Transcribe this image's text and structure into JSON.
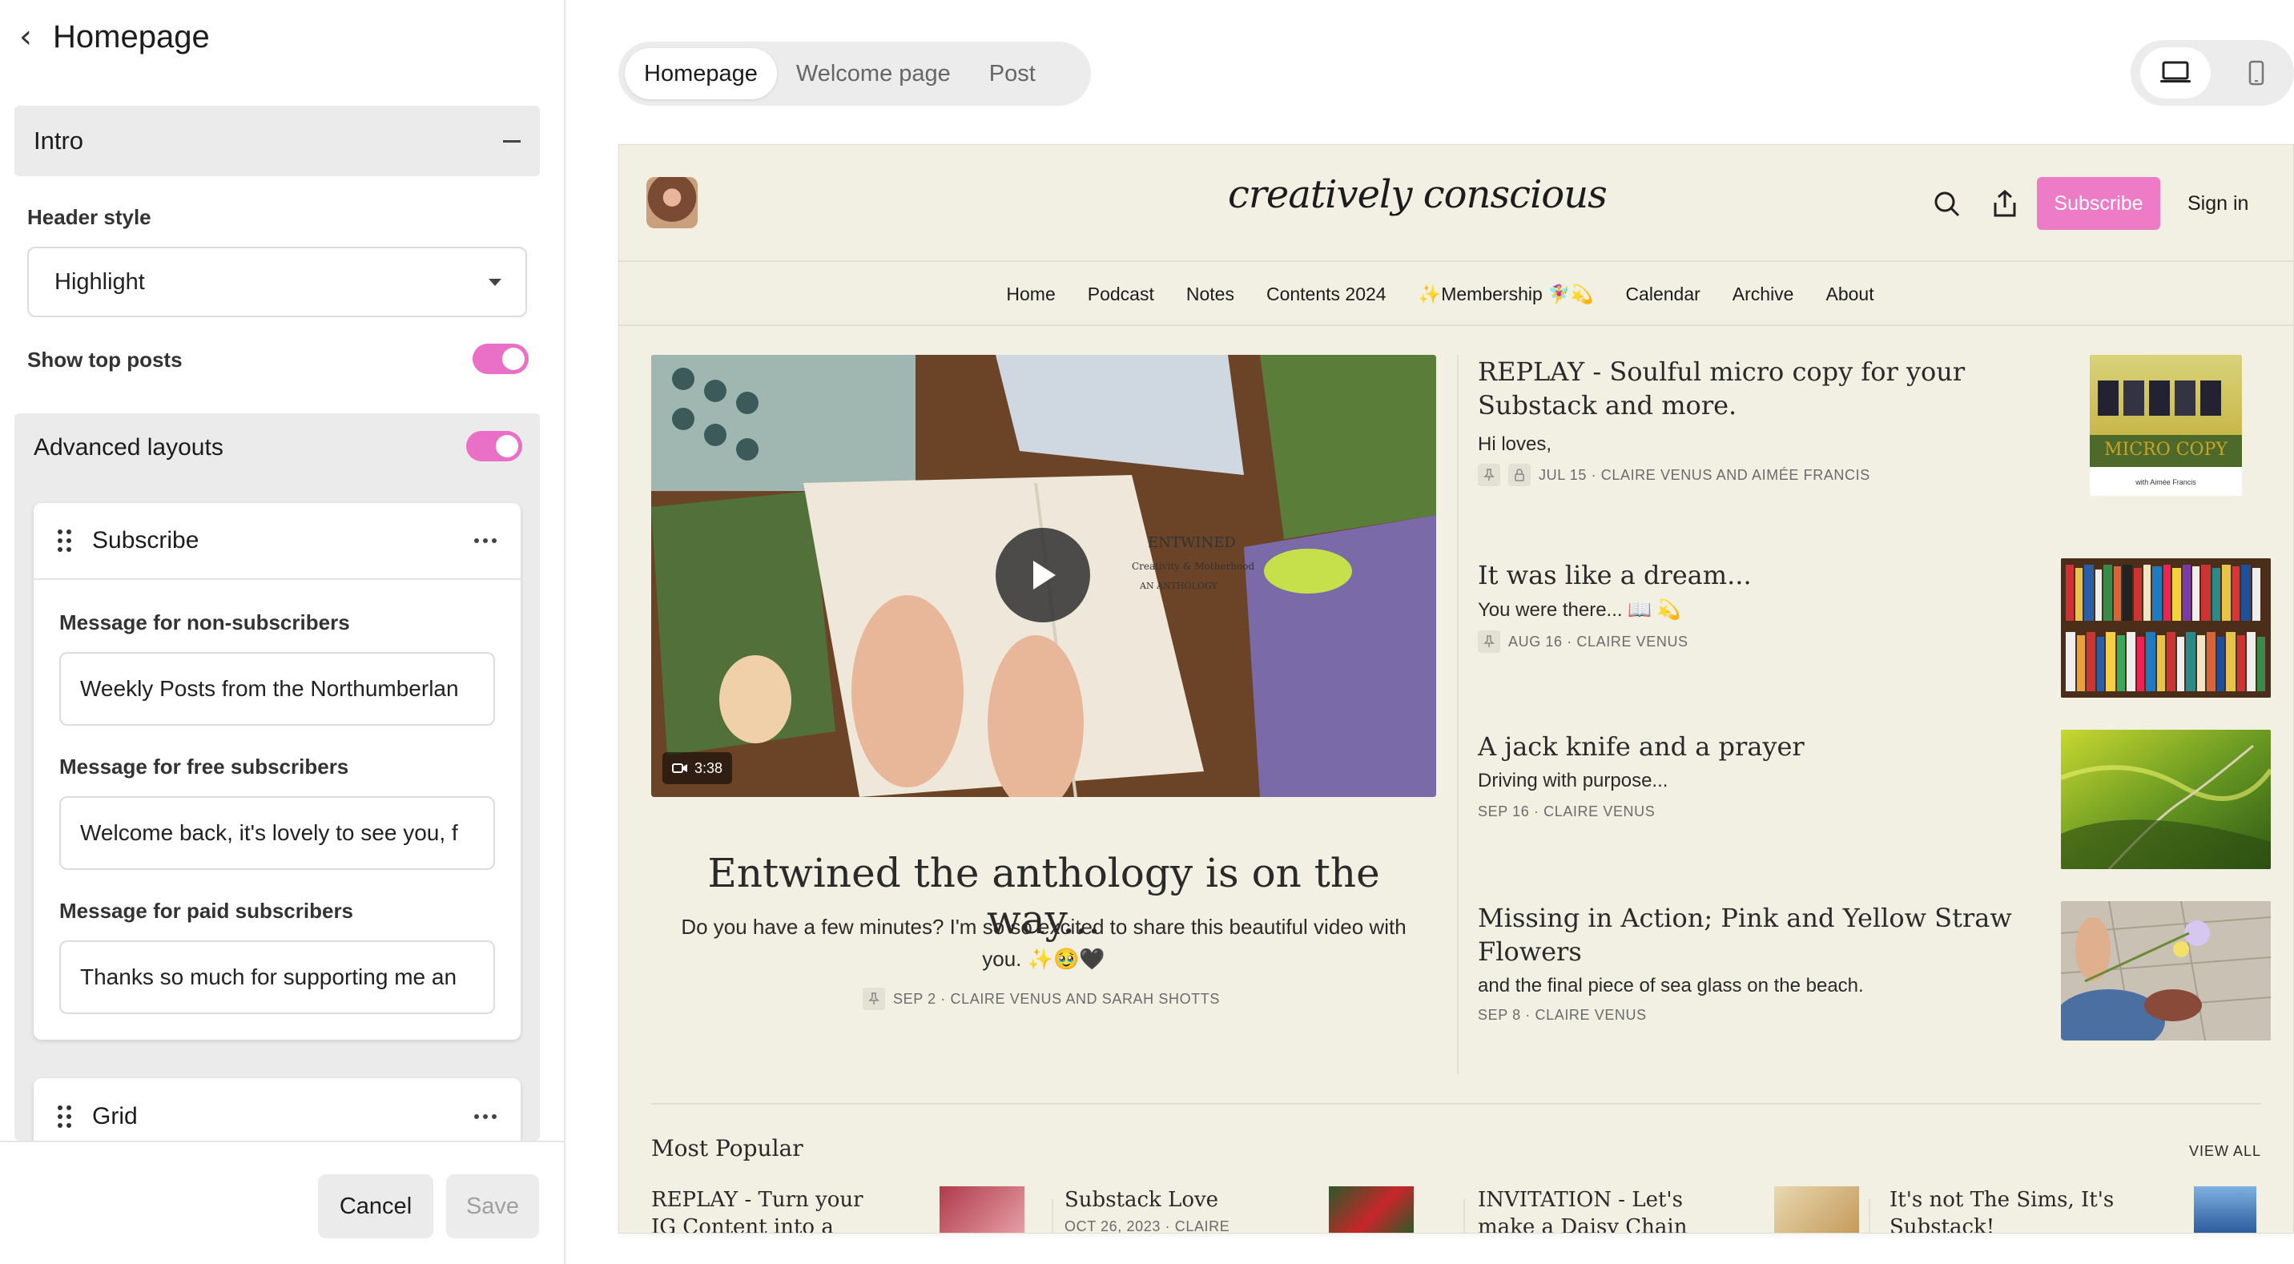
{
  "left_panel": {
    "title": "Homepage",
    "intro_section": "Intro",
    "header_style_label": "Header style",
    "header_style_value": "Highlight",
    "show_top_posts_label": "Show top posts",
    "show_top_posts_on": true,
    "advanced_layouts_label": "Advanced layouts",
    "advanced_layouts_on": true,
    "subscribe_card": {
      "title": "Subscribe",
      "fields": [
        {
          "label": "Message for non-subscribers",
          "value": "Weekly Posts from the Northumberlan"
        },
        {
          "label": "Message for free subscribers",
          "value": "Welcome back, it's lovely to see you, f"
        },
        {
          "label": "Message for paid subscribers",
          "value": "Thanks so much for supporting me an"
        }
      ]
    },
    "grid_card": {
      "title": "Grid"
    },
    "cancel_label": "Cancel",
    "save_label": "Save"
  },
  "preview_tabs": [
    "Homepage",
    "Welcome page",
    "Post"
  ],
  "active_tab": "Homepage",
  "device_switch": {
    "desktop_icon": "laptop-icon",
    "mobile_icon": "phone-icon",
    "active": "desktop"
  },
  "site": {
    "brand": "creatively conscious",
    "subscribe_label": "Subscribe",
    "signin_label": "Sign in",
    "accent_color": "#ed7bc5",
    "background_color": "#f1f0e3",
    "nav": [
      "Home",
      "Podcast",
      "Notes",
      "Contents 2024",
      "✨Membership 🧚‍♀️💫",
      "Calendar",
      "Archive",
      "About"
    ]
  },
  "hero": {
    "duration": "3:38",
    "title": "Entwined the anthology is on the way...",
    "subtitle": "Do you have a few minutes? I'm so so excited to share this beautiful video with you. ✨🥹🖤",
    "meta": "SEP 2 · CLAIRE VENUS AND SARAH SHOTTS"
  },
  "posts": [
    {
      "title": "REPLAY - Soulful micro copy for your Substack and more.",
      "desc": "Hi loves,",
      "meta": "JUL 15 · CLAIRE VENUS AND AIMÉE FRANCIS",
      "thumb_text": "MICRO COPY",
      "thumb_sub": "with Aimée Francis"
    },
    {
      "title": "It was like a dream...",
      "desc": "You were there... 📖 💫",
      "meta": "AUG 16 · CLAIRE VENUS"
    },
    {
      "title": "A jack knife and a prayer",
      "desc": "Driving with purpose...",
      "meta": "SEP 16 · CLAIRE VENUS"
    },
    {
      "title": "Missing in Action; Pink and Yellow Straw Flowers",
      "desc": "and the final piece of sea glass on the beach.",
      "meta": "SEP 8 · CLAIRE VENUS"
    }
  ],
  "most_popular": {
    "title": "Most Popular",
    "view_all": "VIEW ALL",
    "items": [
      {
        "title": "REPLAY - Turn your IG Content into a Digital"
      },
      {
        "title": "Substack Love",
        "meta": "OCT 26, 2023 · CLAIRE"
      },
      {
        "title": "INVITATION - Let's make a Daisy Chain Flower Crown"
      },
      {
        "title": "It's not The Sims, It's Substack!"
      }
    ]
  }
}
